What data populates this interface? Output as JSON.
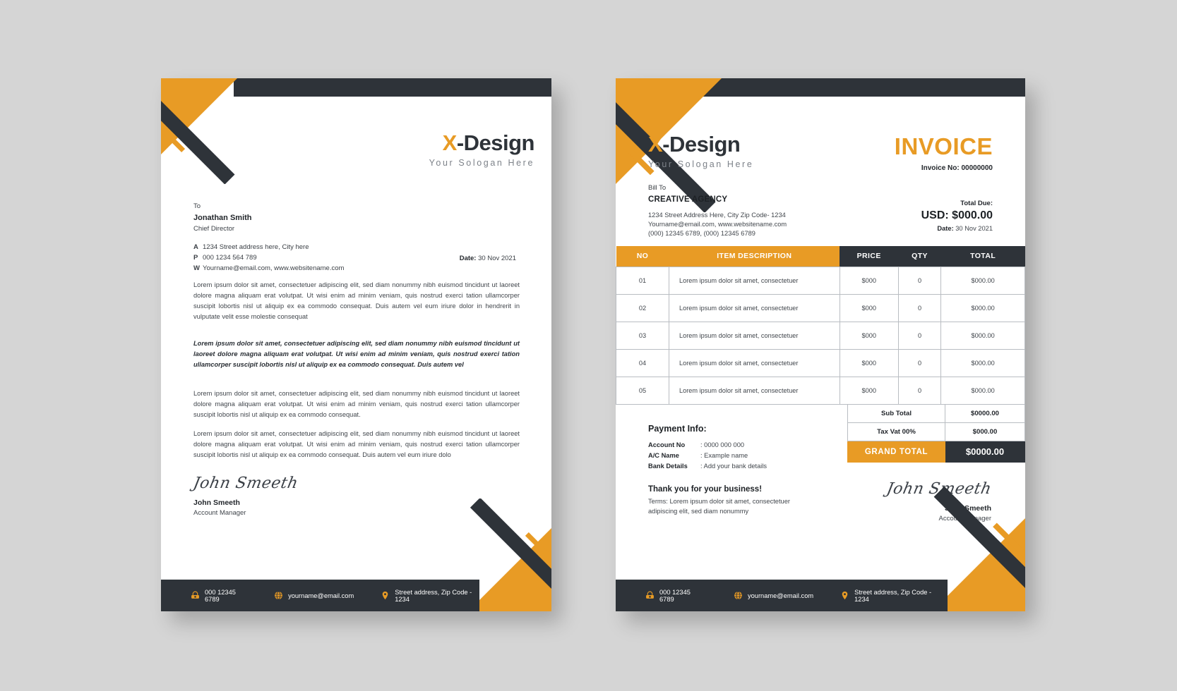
{
  "palette": {
    "orange": "#e89b25",
    "dark": "#2e3339",
    "page_bg": "#d5d5d5",
    "sheet_bg": "#ffffff"
  },
  "brand": {
    "name_accent": "X",
    "name_rest": "-Design",
    "slogan": "Your Sologan Here"
  },
  "letterhead": {
    "recipient": {
      "to_label": "To",
      "name": "Jonathan Smith",
      "role": "Chief Director",
      "contacts": [
        {
          "key": "A",
          "value": "1234 Street address here, City here"
        },
        {
          "key": "P",
          "value": "000 1234 564 789"
        },
        {
          "key": "W",
          "value": "Yourname@email.com, www.websitename.com"
        }
      ]
    },
    "date_label": "Date:",
    "date_value": "30 Nov 2021",
    "paragraphs": [
      "Lorem ipsum dolor sit amet, consectetuer adipiscing elit, sed diam nonummy nibh euismod tincidunt ut laoreet dolore magna aliquam erat volutpat. Ut wisi enim ad minim veniam, quis nostrud exerci tation ullamcorper suscipit lobortis nisl ut aliquip ex ea commodo consequat. Duis autem vel eum iriure dolor in hendrerit in vulputate velit esse molestie consequat",
      "Lorem ipsum dolor sit amet, consectetuer adipiscing elit, sed diam nonummy nibh euismod tincidunt ut laoreet dolore magna aliquam erat volutpat. Ut wisi enim ad minim veniam, quis nostrud exerci tation ullamcorper suscipit lobortis nisl ut aliquip ex ea commodo consequat. Duis autem vel",
      "Lorem ipsum dolor sit amet, consectetuer adipiscing elit, sed diam nonummy nibh euismod tincidunt ut laoreet dolore magna aliquam erat volutpat. Ut wisi enim ad minim veniam, quis nostrud exerci tation ullamcorper suscipit lobortis nisl ut aliquip ex ea commodo consequat.",
      "Lorem ipsum dolor sit amet, consectetuer adipiscing elit, sed diam nonummy nibh euismod tincidunt ut laoreet dolore magna aliquam erat volutpat. Ut wisi enim ad minim veniam, quis nostrud exerci tation ullamcorper suscipit lobortis nisl ut aliquip ex ea commodo consequat. Duis autem vel eum iriure dolo"
    ],
    "signature": {
      "script": "John Smeeth",
      "name": "John Smeeth",
      "role": "Account Manager"
    }
  },
  "invoice": {
    "title": "INVOICE",
    "invoice_no_label": "Invoice No:",
    "invoice_no_value": "00000000",
    "bill": {
      "label": "Bill To",
      "company": "CREATIVE AGENCY",
      "lines": [
        "1234 Street Address Here, City Zip Code- 1234",
        "Yourname@email.com, www.websitename.com",
        "(000) 12345 6789, (000) 12345 6789"
      ]
    },
    "due": {
      "label": "Total Due:",
      "amount": "USD: $000.00",
      "date_label": "Date:",
      "date_value": "30 Nov 2021"
    },
    "table": {
      "headers": [
        "NO",
        "ITEM DESCRIPTION",
        "PRICE",
        "QTY",
        "TOTAL"
      ],
      "rows": [
        {
          "no": "01",
          "desc": "Lorem ipsum dolor sit amet, consectetuer",
          "price": "$000",
          "qty": "0",
          "total": "$000.00"
        },
        {
          "no": "02",
          "desc": "Lorem ipsum dolor sit amet, consectetuer",
          "price": "$000",
          "qty": "0",
          "total": "$000.00"
        },
        {
          "no": "03",
          "desc": "Lorem ipsum dolor sit amet, consectetuer",
          "price": "$000",
          "qty": "0",
          "total": "$000.00"
        },
        {
          "no": "04",
          "desc": "Lorem ipsum dolor sit amet, consectetuer",
          "price": "$000",
          "qty": "0",
          "total": "$000.00"
        },
        {
          "no": "05",
          "desc": "Lorem ipsum dolor sit amet, consectetuer",
          "price": "$000",
          "qty": "0",
          "total": "$000.00"
        }
      ]
    },
    "totals": [
      {
        "label": "Sub Total",
        "value": "$0000.00"
      },
      {
        "label": "Tax Vat 00%",
        "value": "$000.00"
      },
      {
        "label": "GRAND  TOTAL",
        "value": "$0000.00"
      }
    ],
    "payment": {
      "title": "Payment Info:",
      "rows": [
        {
          "key": "Account No",
          "value": ": 0000 000 000"
        },
        {
          "key": "A/C Name",
          "value": ": Example name"
        },
        {
          "key": "Bank Details",
          "value": ": Add your bank details"
        }
      ]
    },
    "thanks": "Thank you for your business!",
    "terms": "Terms: Lorem ipsum dolor sit amet, consectetuer adipiscing elit, sed diam nonummy",
    "signature": {
      "script": "John Smeeth",
      "name": "John Smeeth",
      "role": "Account Manager"
    }
  },
  "footer": {
    "phone": "000 12345 6789",
    "email": "yourname@email.com",
    "address": "Street address, Zip Code - 1234",
    "icons": [
      "telephone-icon",
      "globe-icon",
      "location-pin-icon"
    ]
  }
}
